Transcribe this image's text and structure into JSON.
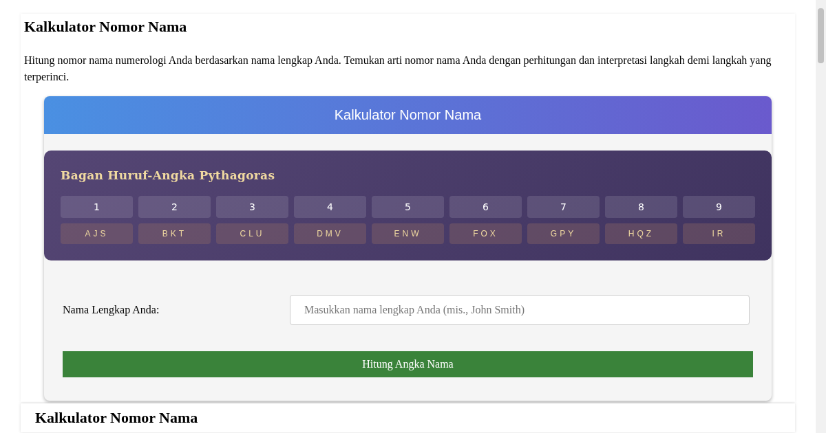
{
  "page_title": "Kalkulator Nomor Nama",
  "intro": "Hitung nomor nama numerologi Anda berdasarkan nama lengkap Anda. Temukan arti nomor nama Anda dengan perhitungan dan interpretasi langkah demi langkah yang terperinci.",
  "calculator": {
    "header": "Kalkulator Nomor Nama",
    "chart": {
      "title": "Bagan Huruf-Angka Pythagoras",
      "columns": [
        {
          "number": "1",
          "letters": "AJS"
        },
        {
          "number": "2",
          "letters": "BKT"
        },
        {
          "number": "3",
          "letters": "CLU"
        },
        {
          "number": "4",
          "letters": "DMV"
        },
        {
          "number": "5",
          "letters": "ENW"
        },
        {
          "number": "6",
          "letters": "FOX"
        },
        {
          "number": "7",
          "letters": "GPY"
        },
        {
          "number": "8",
          "letters": "HQZ"
        },
        {
          "number": "9",
          "letters": "IR"
        }
      ]
    },
    "name_field": {
      "label": "Nama Lengkap Anda:",
      "placeholder": "Masukkan nama lengkap Anda (mis., John Smith)"
    },
    "submit": "Hitung Angka Nama"
  },
  "next_section": {
    "title": "Kalkulator Nomor Nama"
  }
}
